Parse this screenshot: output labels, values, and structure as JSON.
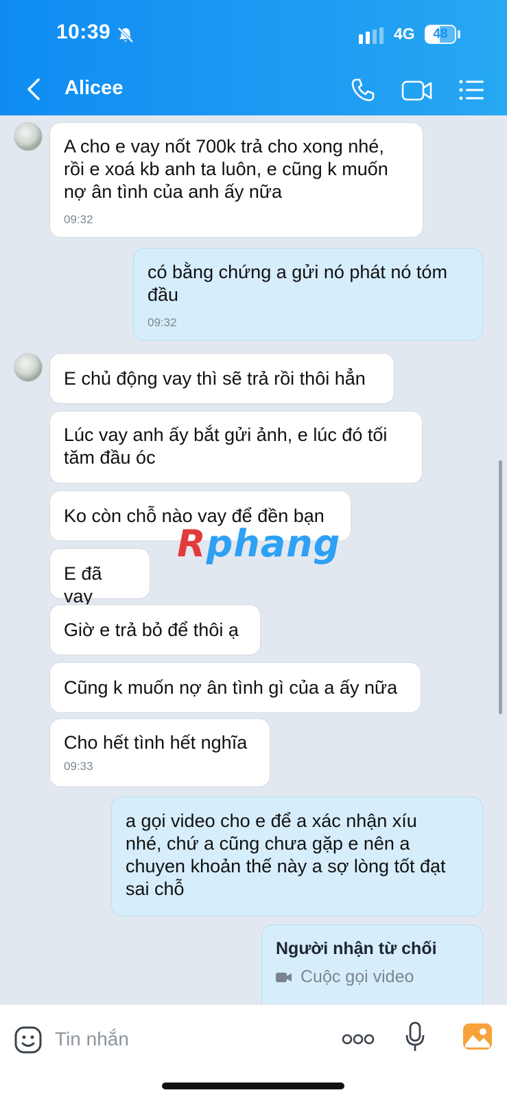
{
  "status_bar": {
    "time": "10:39",
    "network": "4G",
    "battery": "48",
    "battery_level": 0.48
  },
  "header": {
    "contact_name": "Alicee",
    "back_icon": "chevron-left-icon",
    "call_icon": "phone-icon",
    "video_icon": "video-camera-icon",
    "menu_icon": "list-menu-icon",
    "color": "#1e9bf3"
  },
  "messages": [
    {
      "sender": "them",
      "text": "A cho e vay nốt 700k trả cho xong nhé,\nrồi e xoá kb anh ta luôn, e cũng k muốn\nnợ ân tình của anh ấy nữa",
      "time": "09:32"
    },
    {
      "sender": "me",
      "text": "có bằng chứng a gửi nó phát nó tóm\nđầu",
      "time": "09:32"
    },
    {
      "sender": "them",
      "text": "E chủ động vay thì sẽ trả rồi thôi hẳn"
    },
    {
      "sender": "them",
      "text": "Lúc vay anh ấy bắt gửi ảnh, e lúc đó tối\ntăm đầu óc"
    },
    {
      "sender": "them",
      "text": "Ko còn chỗ nào vay để đền bạn"
    },
    {
      "sender": "them",
      "text": "E đã vay"
    },
    {
      "sender": "them",
      "text": "Giờ e trả bỏ để thôi ạ"
    },
    {
      "sender": "them",
      "text": "Cũng k muốn nợ ân tình gì của a ấy nữa"
    },
    {
      "sender": "them",
      "text": "Cho hết tình hết nghĩa",
      "time": "09:33"
    },
    {
      "sender": "me",
      "text": "a gọi video cho e để a xác nhận xíu\nnhé, chứ a cũng chưa gặp e nên a\nchuyen khoản thế này a sợ lòng tốt đạt\nsai chỗ"
    }
  ],
  "call_card": {
    "title": "Người nhận từ chối",
    "subtitle": "Cuộc gọi video"
  },
  "watermark": {
    "first": "R",
    "rest": "phang"
  },
  "input_bar": {
    "placeholder": "Tin nhắn",
    "more_icon": "more-dots-icon",
    "mic_icon": "microphone-icon",
    "gallery_icon": "image-gallery-icon",
    "emoji_icon": "emoji-icon"
  },
  "colors": {
    "incoming_bubble": "#ffffff",
    "outgoing_bubble": "#d6edfb",
    "chat_background": "#e2e8ef"
  }
}
